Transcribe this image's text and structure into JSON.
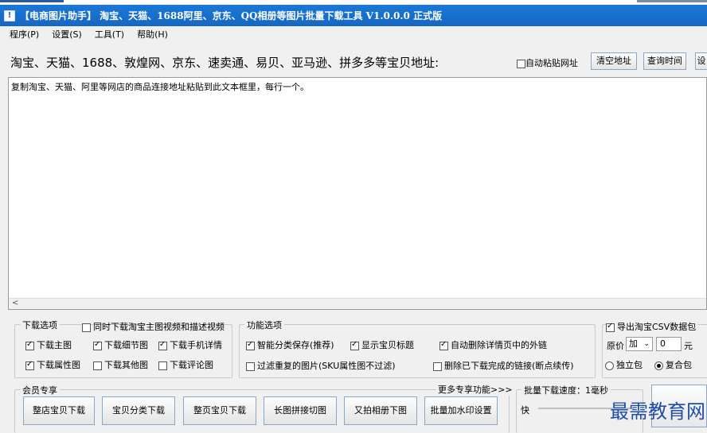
{
  "window": {
    "title": "【电商图片助手】 淘宝、天猫、1688阿里、京东、QQ相册等图片批量下载工具 V1.0.0.0 正式版",
    "icon": "download-app-icon",
    "icon_glyph": "!"
  },
  "menu": [
    "程序(P)",
    "设置(S)",
    "工具(T)",
    "帮助(H)"
  ],
  "url_row": {
    "label": "淘宝、天猫、1688、敦煌网、京东、速卖通、易贝、亚马逊、拼多多等宝贝地址:",
    "auto_paste": "自动粘贴网址",
    "auto_paste_checked": false,
    "clear_btn": "清空地址",
    "query_btn": "查询时间",
    "settings_btn": "设"
  },
  "textarea": {
    "value": "复制淘宝、天猫、阿里等网店的商品连接地址粘贴到此文本框里，每行一个。"
  },
  "scrollbar": {
    "left_arrow": "<"
  },
  "download_options": {
    "title": "下载选项",
    "video_option": "同时下载淘宝主图视频和描述视频",
    "video_checked": false,
    "opt1": "下载主图",
    "opt1_checked": true,
    "opt2": "下载细节图",
    "opt2_checked": true,
    "opt3": "下载手机详情",
    "opt3_checked": true,
    "opt4": "下载属性图",
    "opt4_checked": true,
    "opt5": "下载其他图",
    "opt5_checked": false,
    "opt6": "下载评论图",
    "opt6_checked": false
  },
  "function_options": {
    "title": "功能选项",
    "opt1": "智能分类保存(推荐)",
    "opt1_checked": true,
    "opt2": "显示宝贝标题",
    "opt2_checked": true,
    "opt3": "自动删除详情页中的外链",
    "opt3_checked": true,
    "opt4": "过滤重复的图片(SKU属性图不过滤)",
    "opt4_checked": false,
    "opt5": "删除已下载完成的链接(断点续传)",
    "opt5_checked": false
  },
  "csv_group": {
    "export_csv": "导出淘宝CSV数据包",
    "export_checked": true,
    "price_label": "原价",
    "price_op": "加",
    "price_value": "0",
    "price_unit": "元",
    "radio1": "独立包",
    "radio1_checked": false,
    "radio2": "复合包",
    "radio2_checked": true
  },
  "member": {
    "title": "会员专享",
    "more": "更多专享功能>>>",
    "btn1": "整店宝贝下载",
    "btn2": "宝贝分类下载",
    "btn3": "整页宝贝下载",
    "btn4": "长图拼接切图",
    "btn5": "又拍相册下图",
    "btn6": "批量加水印设置"
  },
  "speed": {
    "title": "批量下载速度：1毫秒",
    "fast_label": "快"
  },
  "watermark": "最需教育网"
}
